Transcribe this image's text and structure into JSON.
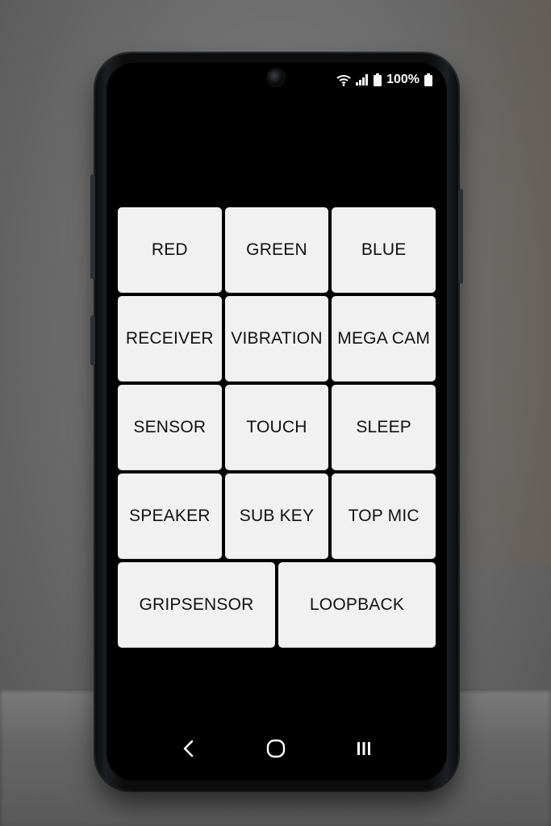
{
  "status_bar": {
    "battery_percent": "100%",
    "icons": [
      "wifi-icon",
      "signal-icon",
      "battery-icon",
      "battery-icon"
    ]
  },
  "test_menu": {
    "rows": [
      [
        {
          "label": "RED"
        },
        {
          "label": "GREEN"
        },
        {
          "label": "BLUE"
        }
      ],
      [
        {
          "label": "RECEIVER"
        },
        {
          "label": "VIBRATION"
        },
        {
          "label": "MEGA CAM"
        }
      ],
      [
        {
          "label": "SENSOR"
        },
        {
          "label": "TOUCH"
        },
        {
          "label": "SLEEP"
        }
      ],
      [
        {
          "label": "SPEAKER"
        },
        {
          "label": "SUB KEY"
        },
        {
          "label": "TOP MIC"
        }
      ],
      [
        {
          "label": "GRIPSENSOR"
        },
        {
          "label": "LOOPBACK"
        }
      ]
    ]
  },
  "navigation": {
    "buttons": [
      "back-icon",
      "home-icon",
      "recents-icon"
    ]
  },
  "colors": {
    "screen_background": "#000000",
    "tile_background": "#f1f1f1",
    "tile_text": "#111111",
    "phone_frame": "#0c0c0c"
  }
}
